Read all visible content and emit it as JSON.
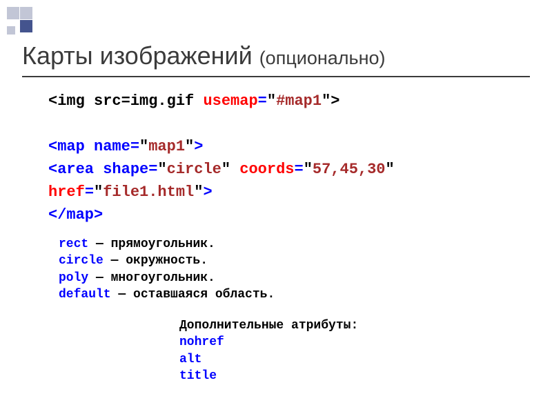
{
  "title": {
    "main": "Карты изображений ",
    "sub": "(опционально)"
  },
  "code1": {
    "l1": {
      "a": "<img src=img.gif ",
      "b": "usemap",
      "c": "=",
      "d": "\"",
      "e": "#map1",
      "f": "\"",
      "g": ">"
    },
    "l2": {
      "a": "<",
      "b": "map name",
      "c": "=",
      "d": "\"",
      "e": "map1",
      "f": "\"",
      "g": ">"
    },
    "l3": {
      "a": "<",
      "b": "area shape",
      "c": "=",
      "d": "\"",
      "e": "circle",
      "f": "\"",
      "g": " ",
      "h": "coords",
      "i": "=",
      "j": "\"",
      "k": "57,45,30",
      "l": "\""
    },
    "l4": {
      "a": "href",
      "b": "=",
      "c": "\"",
      "d": "file1.html",
      "e": "\"",
      "f": ">"
    },
    "l5": {
      "a": "</",
      "b": "map",
      "c": ">"
    }
  },
  "code2": {
    "r1": {
      "k": "rect",
      "d": " — прямоугольник."
    },
    "r2": {
      "k": "circle",
      "d": " — окружность."
    },
    "r3": {
      "k": "poly",
      "d": " — многоугольник."
    },
    "r4": {
      "k": "default",
      "d": " — оставшаяся область."
    }
  },
  "code3": {
    "head": "Дополнительные атрибуты:",
    "a1": "nohref",
    "a2": "alt",
    "a3": "title"
  }
}
